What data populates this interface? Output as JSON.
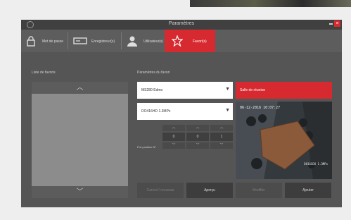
{
  "window": {
    "title": "Paramètres"
  },
  "tabs": [
    {
      "label": "Mot de passe",
      "icon": "padlock-icon"
    },
    {
      "label": "Enregistreur(s)",
      "icon": "recorder-icon"
    },
    {
      "label": "Utilisateur(s)",
      "icon": "user-icon"
    },
    {
      "label": "Favori(s)",
      "icon": "star-icon",
      "active": true
    }
  ],
  "left": {
    "section_label": "Liste de favoris",
    "up": "︿",
    "down": "﹀"
  },
  "right": {
    "section_label": "Paramètres du favori",
    "recorder_select": "MS280 Edmo",
    "camera_select": "DO416HD 1.3MPx",
    "name_field": "Salle de réunion",
    "preposition_label": "Pré-position N°",
    "preposition_values": [
      "0",
      "0",
      "1"
    ],
    "arrow_up": "︿",
    "arrow_down": "﹀",
    "camera_timestamp": "06-12-2016 10:07:27",
    "camera_id": "DO16SDX 1.3MPx"
  },
  "buttons": [
    {
      "label": "Cancel / nouveau",
      "state": "disabled"
    },
    {
      "label": "Aperçu",
      "state": "normal"
    },
    {
      "label": "Modifier",
      "state": "disabled"
    },
    {
      "label": "Ajouter",
      "state": "normal"
    }
  ],
  "colors": {
    "accent": "#d72a30",
    "window": "#555555",
    "panel": "#8c8c8c"
  }
}
